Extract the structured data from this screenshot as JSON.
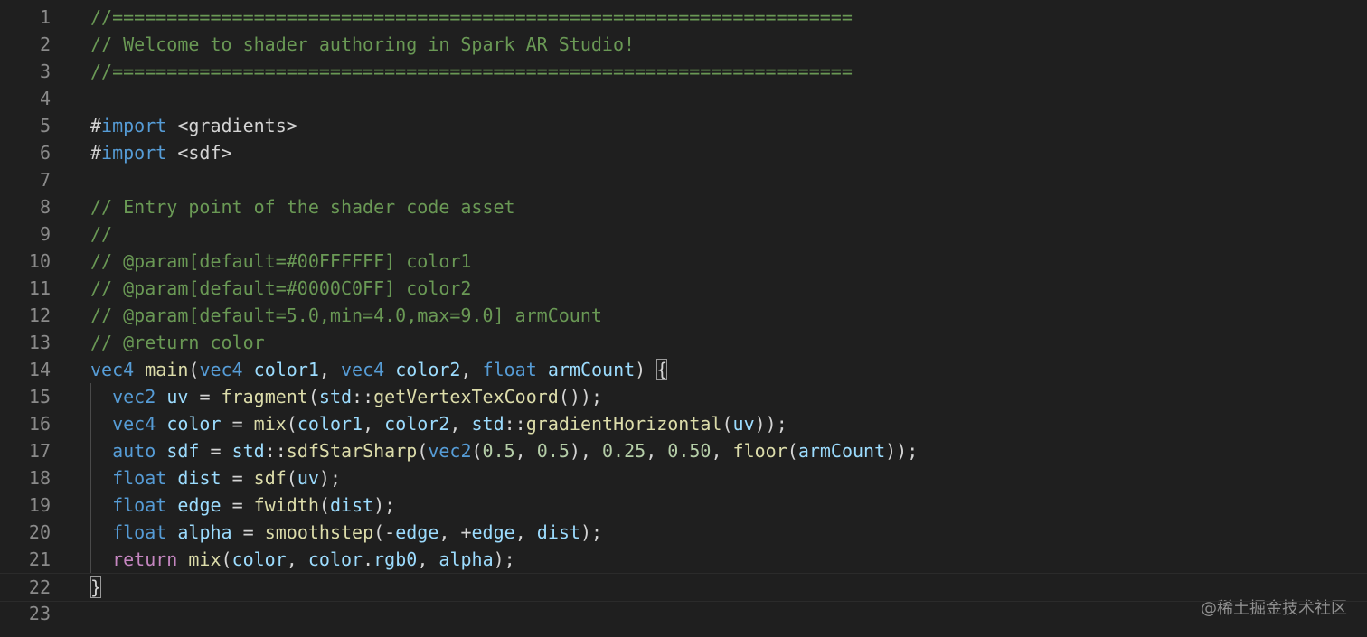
{
  "editor": {
    "lines": [
      {
        "n": "1",
        "t": [
          {
            "c": "comment",
            "s": "//===================================================================="
          }
        ]
      },
      {
        "n": "2",
        "t": [
          {
            "c": "comment",
            "s": "// Welcome to shader authoring in Spark AR Studio!"
          }
        ]
      },
      {
        "n": "3",
        "t": [
          {
            "c": "comment",
            "s": "//===================================================================="
          }
        ]
      },
      {
        "n": "4",
        "t": []
      },
      {
        "n": "5",
        "t": [
          {
            "c": "plain",
            "s": "#"
          },
          {
            "c": "kw",
            "s": "import"
          },
          {
            "c": "plain",
            "s": " <gradients>"
          }
        ]
      },
      {
        "n": "6",
        "t": [
          {
            "c": "plain",
            "s": "#"
          },
          {
            "c": "kw",
            "s": "import"
          },
          {
            "c": "plain",
            "s": " <sdf>"
          }
        ]
      },
      {
        "n": "7",
        "t": []
      },
      {
        "n": "8",
        "t": [
          {
            "c": "comment",
            "s": "// Entry point of the shader code asset"
          }
        ]
      },
      {
        "n": "9",
        "t": [
          {
            "c": "comment",
            "s": "//"
          }
        ]
      },
      {
        "n": "10",
        "t": [
          {
            "c": "comment",
            "s": "// @param[default=#00FFFFFF] color1"
          }
        ]
      },
      {
        "n": "11",
        "t": [
          {
            "c": "comment",
            "s": "// @param[default=#0000C0FF] color2"
          }
        ]
      },
      {
        "n": "12",
        "t": [
          {
            "c": "comment",
            "s": "// @param[default=5.0,min=4.0,max=9.0] armCount"
          }
        ]
      },
      {
        "n": "13",
        "t": [
          {
            "c": "comment",
            "s": "// @return color"
          }
        ]
      },
      {
        "n": "14",
        "t": [
          {
            "c": "kw",
            "s": "vec4"
          },
          {
            "c": "plain",
            "s": " "
          },
          {
            "c": "fn",
            "s": "main"
          },
          {
            "c": "plain",
            "s": "("
          },
          {
            "c": "kw",
            "s": "vec4"
          },
          {
            "c": "plain",
            "s": " "
          },
          {
            "c": "var",
            "s": "color1"
          },
          {
            "c": "plain",
            "s": ", "
          },
          {
            "c": "kw",
            "s": "vec4"
          },
          {
            "c": "plain",
            "s": " "
          },
          {
            "c": "var",
            "s": "color2"
          },
          {
            "c": "plain",
            "s": ", "
          },
          {
            "c": "kw",
            "s": "float"
          },
          {
            "c": "plain",
            "s": " "
          },
          {
            "c": "var",
            "s": "armCount"
          },
          {
            "c": "plain",
            "s": ") "
          },
          {
            "c": "bracket",
            "s": "{"
          }
        ]
      },
      {
        "n": "15",
        "t": [
          {
            "c": "plain",
            "s": "  "
          },
          {
            "c": "kw",
            "s": "vec2"
          },
          {
            "c": "plain",
            "s": " "
          },
          {
            "c": "var",
            "s": "uv"
          },
          {
            "c": "plain",
            "s": " = "
          },
          {
            "c": "fn",
            "s": "fragment"
          },
          {
            "c": "plain",
            "s": "("
          },
          {
            "c": "var",
            "s": "std"
          },
          {
            "c": "plain",
            "s": "::"
          },
          {
            "c": "fn",
            "s": "getVertexTexCoord"
          },
          {
            "c": "plain",
            "s": "());"
          }
        ]
      },
      {
        "n": "16",
        "t": [
          {
            "c": "plain",
            "s": "  "
          },
          {
            "c": "kw",
            "s": "vec4"
          },
          {
            "c": "plain",
            "s": " "
          },
          {
            "c": "var",
            "s": "color"
          },
          {
            "c": "plain",
            "s": " = "
          },
          {
            "c": "fn",
            "s": "mix"
          },
          {
            "c": "plain",
            "s": "("
          },
          {
            "c": "var",
            "s": "color1"
          },
          {
            "c": "plain",
            "s": ", "
          },
          {
            "c": "var",
            "s": "color2"
          },
          {
            "c": "plain",
            "s": ", "
          },
          {
            "c": "var",
            "s": "std"
          },
          {
            "c": "plain",
            "s": "::"
          },
          {
            "c": "fn",
            "s": "gradientHorizontal"
          },
          {
            "c": "plain",
            "s": "("
          },
          {
            "c": "var",
            "s": "uv"
          },
          {
            "c": "plain",
            "s": "));"
          }
        ]
      },
      {
        "n": "17",
        "t": [
          {
            "c": "plain",
            "s": "  "
          },
          {
            "c": "kw",
            "s": "auto"
          },
          {
            "c": "plain",
            "s": " "
          },
          {
            "c": "var",
            "s": "sdf"
          },
          {
            "c": "plain",
            "s": " = "
          },
          {
            "c": "var",
            "s": "std"
          },
          {
            "c": "plain",
            "s": "::"
          },
          {
            "c": "fn",
            "s": "sdfStarSharp"
          },
          {
            "c": "plain",
            "s": "("
          },
          {
            "c": "kw",
            "s": "vec2"
          },
          {
            "c": "plain",
            "s": "("
          },
          {
            "c": "num",
            "s": "0.5"
          },
          {
            "c": "plain",
            "s": ", "
          },
          {
            "c": "num",
            "s": "0.5"
          },
          {
            "c": "plain",
            "s": "), "
          },
          {
            "c": "num",
            "s": "0.25"
          },
          {
            "c": "plain",
            "s": ", "
          },
          {
            "c": "num",
            "s": "0.50"
          },
          {
            "c": "plain",
            "s": ", "
          },
          {
            "c": "fn",
            "s": "floor"
          },
          {
            "c": "plain",
            "s": "("
          },
          {
            "c": "var",
            "s": "armCount"
          },
          {
            "c": "plain",
            "s": "));"
          }
        ]
      },
      {
        "n": "18",
        "t": [
          {
            "c": "plain",
            "s": "  "
          },
          {
            "c": "kw",
            "s": "float"
          },
          {
            "c": "plain",
            "s": " "
          },
          {
            "c": "var",
            "s": "dist"
          },
          {
            "c": "plain",
            "s": " = "
          },
          {
            "c": "fn",
            "s": "sdf"
          },
          {
            "c": "plain",
            "s": "("
          },
          {
            "c": "var",
            "s": "uv"
          },
          {
            "c": "plain",
            "s": ");"
          }
        ]
      },
      {
        "n": "19",
        "t": [
          {
            "c": "plain",
            "s": "  "
          },
          {
            "c": "kw",
            "s": "float"
          },
          {
            "c": "plain",
            "s": " "
          },
          {
            "c": "var",
            "s": "edge"
          },
          {
            "c": "plain",
            "s": " = "
          },
          {
            "c": "fn",
            "s": "fwidth"
          },
          {
            "c": "plain",
            "s": "("
          },
          {
            "c": "var",
            "s": "dist"
          },
          {
            "c": "plain",
            "s": ");"
          }
        ]
      },
      {
        "n": "20",
        "t": [
          {
            "c": "plain",
            "s": "  "
          },
          {
            "c": "kw",
            "s": "float"
          },
          {
            "c": "plain",
            "s": " "
          },
          {
            "c": "var",
            "s": "alpha"
          },
          {
            "c": "plain",
            "s": " = "
          },
          {
            "c": "fn",
            "s": "smoothstep"
          },
          {
            "c": "plain",
            "s": "(-"
          },
          {
            "c": "var",
            "s": "edge"
          },
          {
            "c": "plain",
            "s": ", +"
          },
          {
            "c": "var",
            "s": "edge"
          },
          {
            "c": "plain",
            "s": ", "
          },
          {
            "c": "var",
            "s": "dist"
          },
          {
            "c": "plain",
            "s": ");"
          }
        ]
      },
      {
        "n": "21",
        "t": [
          {
            "c": "plain",
            "s": "  "
          },
          {
            "c": "kw2",
            "s": "return"
          },
          {
            "c": "plain",
            "s": " "
          },
          {
            "c": "fn",
            "s": "mix"
          },
          {
            "c": "plain",
            "s": "("
          },
          {
            "c": "var",
            "s": "color"
          },
          {
            "c": "plain",
            "s": ", "
          },
          {
            "c": "var",
            "s": "color"
          },
          {
            "c": "plain",
            "s": "."
          },
          {
            "c": "var",
            "s": "rgb0"
          },
          {
            "c": "plain",
            "s": ", "
          },
          {
            "c": "var",
            "s": "alpha"
          },
          {
            "c": "plain",
            "s": ");"
          }
        ]
      },
      {
        "n": "22",
        "t": [
          {
            "c": "bracket",
            "s": "}"
          }
        ]
      },
      {
        "n": "23",
        "t": []
      }
    ],
    "active_line": "22",
    "watermark": "@稀土掘金技术社区"
  }
}
